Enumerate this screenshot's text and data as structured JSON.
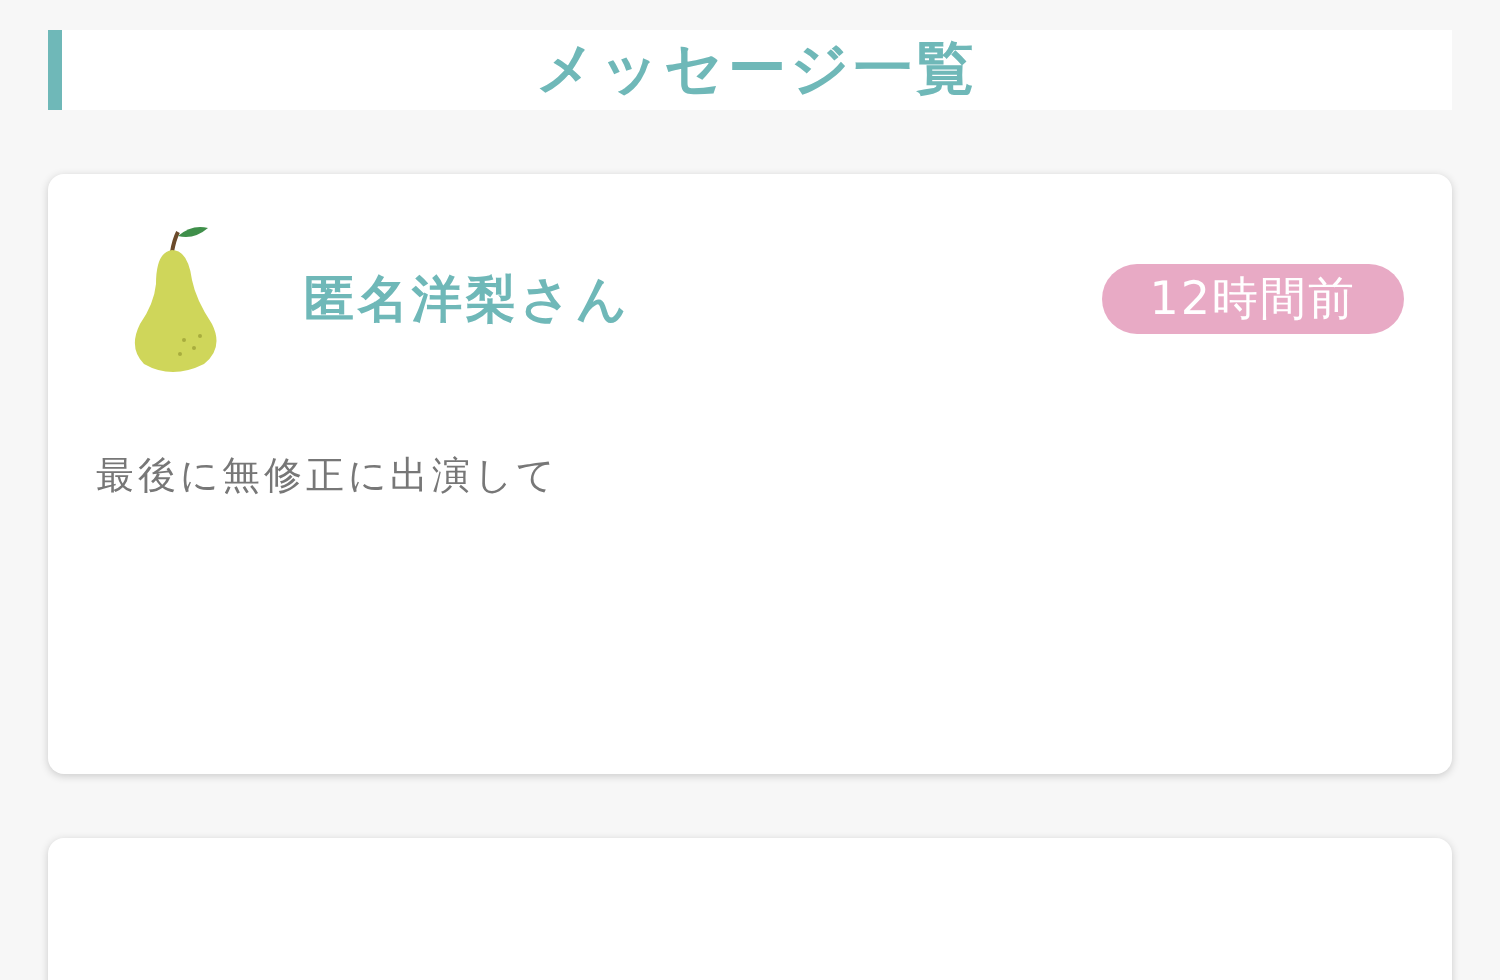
{
  "header": {
    "title": "メッセージ一覧"
  },
  "messages": [
    {
      "name": "匿名洋梨さん",
      "time": "12時間前",
      "text": "最後に無修正に出演して"
    }
  ]
}
